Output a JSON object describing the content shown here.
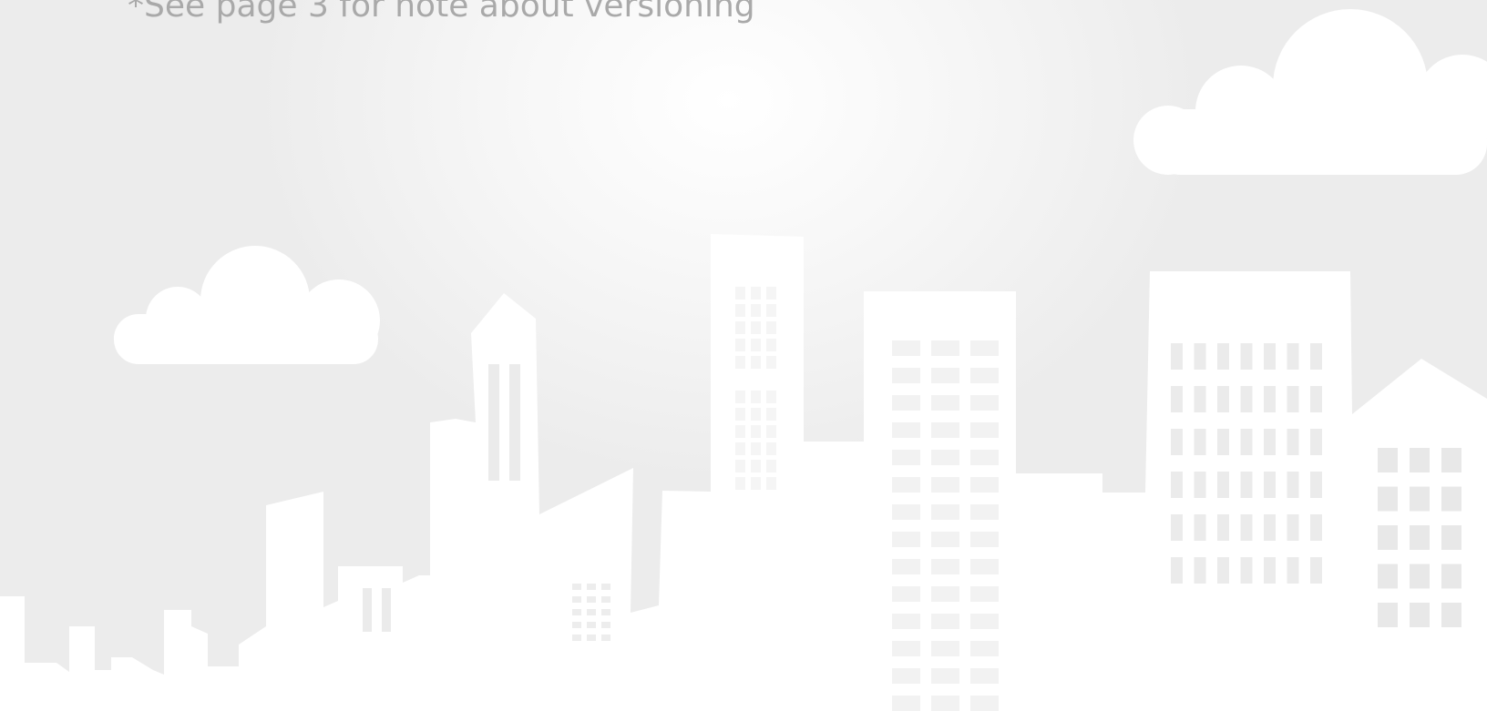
{
  "note": "*See page 3 for note about versioning",
  "colors": {
    "background_light": "#ffffff",
    "background_dark": "#ececec",
    "note_text": "#a9a9a9",
    "silhouette": "#ffffff",
    "window": "#ebebeb"
  },
  "icons": [
    "cloud-icon",
    "city-skyline-icon"
  ]
}
